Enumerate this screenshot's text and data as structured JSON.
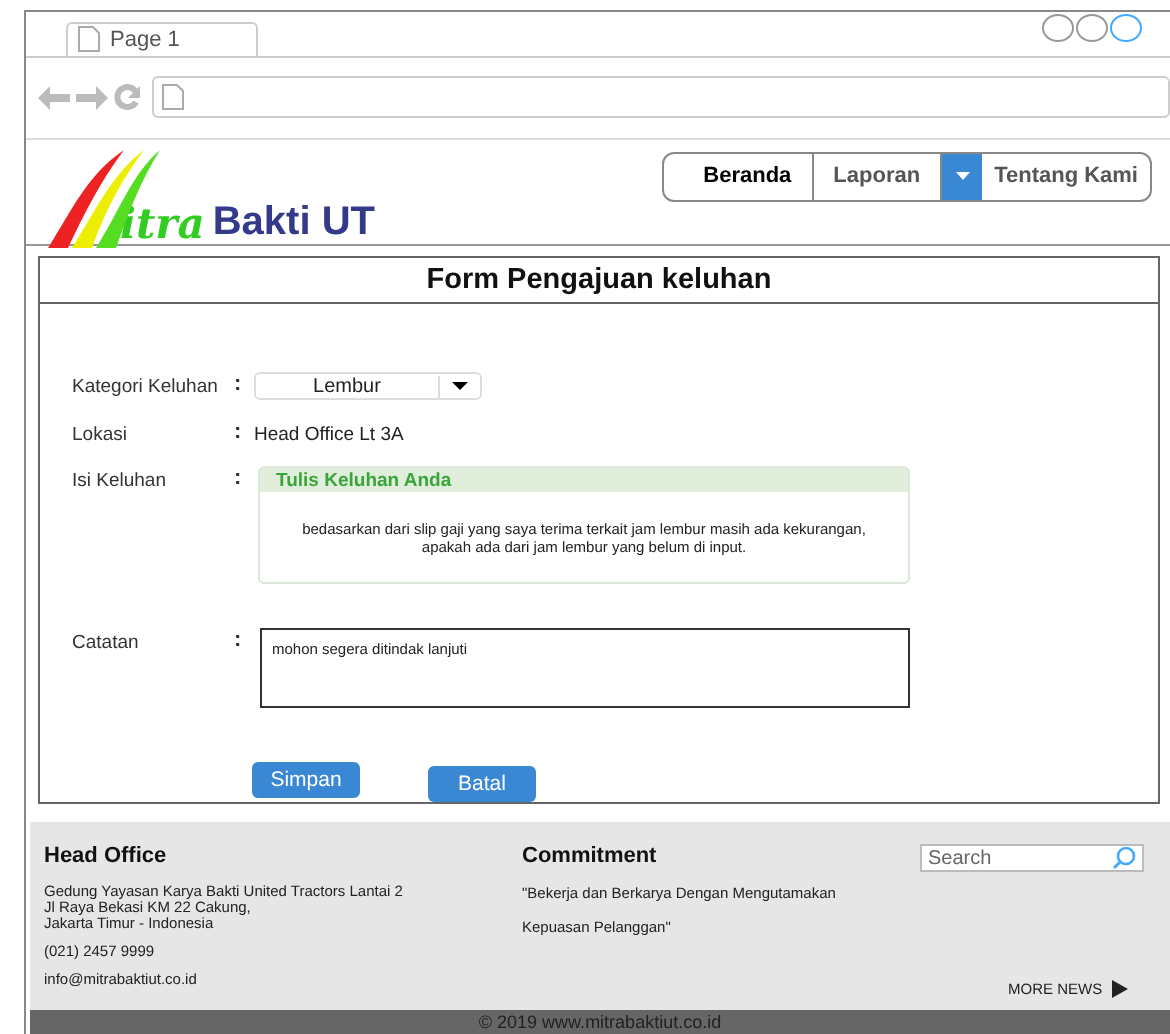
{
  "browser": {
    "tab": "Page 1"
  },
  "brand": {
    "script": "itra",
    "name": "Bakti UT"
  },
  "nav": [
    {
      "label": "Beranda",
      "selected": true,
      "has_menu": false
    },
    {
      "label": "Laporan",
      "selected": false,
      "has_menu": true
    },
    {
      "label": "Tentang Kami",
      "selected": false,
      "has_menu": false
    }
  ],
  "form": {
    "title": "Form Pengajuan keluhan",
    "fields": [
      {
        "kind": "select",
        "label": "Kategori Keluhan",
        "colon": ":",
        "value": "Lembur"
      },
      {
        "kind": "text",
        "label": "Lokasi",
        "colon": ":",
        "value": "Head Office Lt 3A"
      },
      {
        "kind": "panel",
        "label": "Isi Keluhan",
        "colon": ":",
        "heading": "Tulis Keluhan Anda",
        "value": "bedasarkan dari slip gaji yang saya terima terkait jam lembur masih ada kekurangan, apakah ada dari jam lembur yang belum di input."
      },
      {
        "kind": "textarea",
        "label": "Catatan",
        "colon": ":",
        "value": "mohon segera ditindak lanjuti"
      }
    ],
    "buttons": [
      "Simpan",
      "Batal"
    ]
  },
  "footer": {
    "office": {
      "title": "Head Office",
      "address": [
        "Gedung Yayasan Karya Bakti United Tractors Lantai 2",
        "Jl Raya Bekasi KM 22 Cakung,",
        "Jakarta Timur - Indonesia"
      ],
      "phone": "(021) 2457 9999",
      "email": "info@mitrabaktiut.co.id"
    },
    "commitment": {
      "title": "Commitment",
      "lines": [
        "\"Bekerja dan Berkarya Dengan Mengutamakan",
        "Kepuasan Pelanggan\""
      ]
    },
    "search": {
      "placeholder": "Search"
    },
    "more": "MORE NEWS",
    "copyright": "© 2019 www.mitrabaktiut.co.id"
  }
}
